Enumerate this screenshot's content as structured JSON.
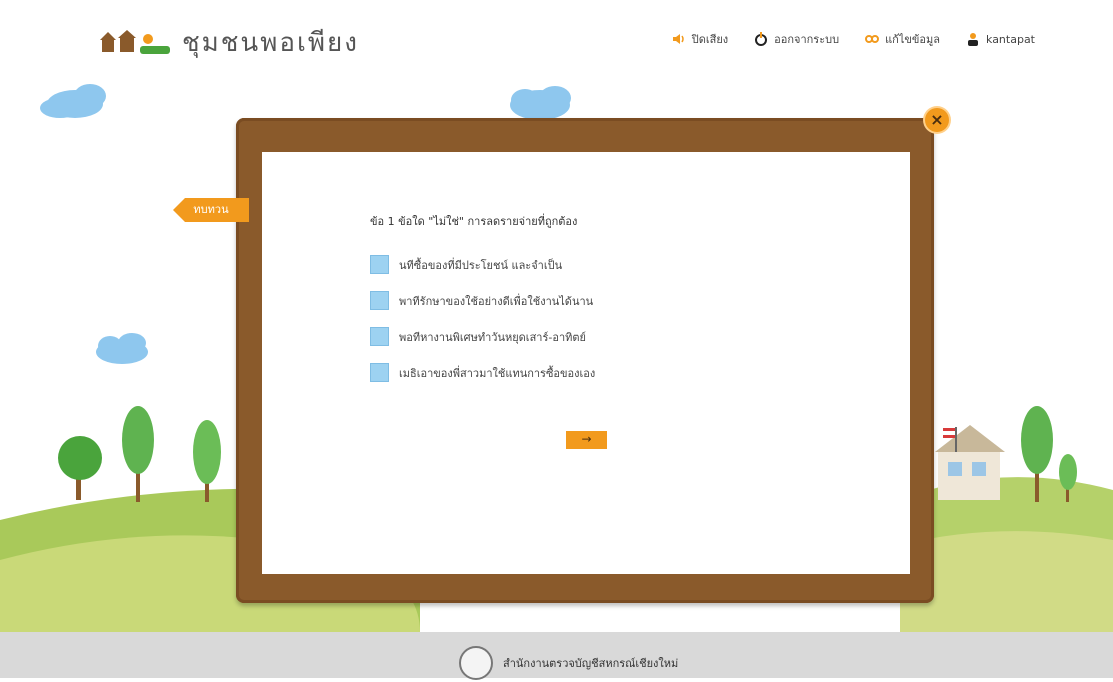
{
  "header": {
    "app_title": "ชุมชนพอเพียง",
    "nav": [
      {
        "label": "ปิดเสียง",
        "icon": "speaker-icon"
      },
      {
        "label": "ออกจากระบบ",
        "icon": "power-icon"
      },
      {
        "label": "แก้ไขข้อมูล",
        "icon": "edit-icon"
      },
      {
        "label": "kantapat",
        "icon": "user-icon"
      }
    ]
  },
  "quiz": {
    "back_label": "ทบทวน",
    "question": "ข้อ 1 ข้อใด \"ไม่ใช่\" การลดรายจ่ายที่ถูกต้อง",
    "options": [
      "นทีซื้อของที่มีประโยชน์ และจำเป็น",
      "พาทีรักษาของใช้อย่างดีเพื่อใช้งานได้นาน",
      "พอทีหางานพิเศษทำวันหยุดเสาร์-อาทิตย์",
      "เมธิเอาของพี่สาวมาใช้แทนการซื้อของเอง"
    ],
    "next_label": "→"
  },
  "footer": {
    "org": "สำนักงานตรวจบัญชีสหกรณ์เชียงใหม่"
  },
  "colors": {
    "accent": "#f29a1d",
    "board": "#8a5a2b",
    "checkbox": "#9dd2f1",
    "footer_bg": "#d9d9d9"
  }
}
